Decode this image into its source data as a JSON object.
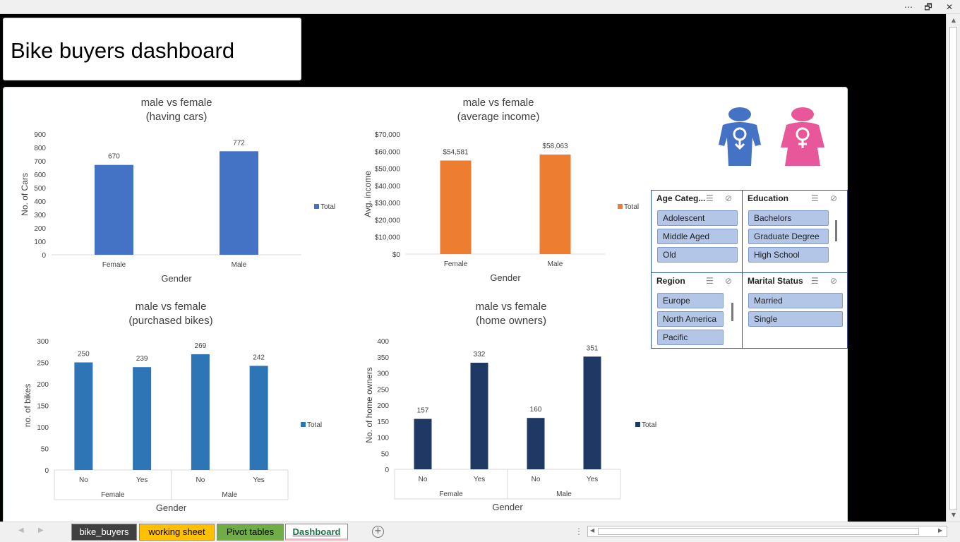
{
  "window": {
    "more_icon": "⋯",
    "restore_icon": "🗗",
    "close_icon": "✕"
  },
  "dashboard": {
    "title": "Bike buyers dashboard"
  },
  "charts": [
    {
      "id": "cars",
      "title_line1": "male vs female",
      "title_line2": "(having cars)",
      "xlabel": "Gender",
      "ylabel": "No. of Cars",
      "legend": "Total",
      "color": "#4472c4"
    },
    {
      "id": "income",
      "title_line1": "male vs female",
      "title_line2": "(average income)",
      "xlabel": "Gender",
      "ylabel": "Avg. income",
      "legend": "Total",
      "color": "#ed7d31"
    },
    {
      "id": "bikes",
      "title_line1": "male vs female",
      "title_line2": "(purchased bikes)",
      "xlabel": "Gender",
      "ylabel": "no. of bikes",
      "legend": "Total",
      "color": "#2e75b6"
    },
    {
      "id": "home",
      "title_line1": "male vs female",
      "title_line2": "(home owners)",
      "xlabel": "Gender",
      "ylabel": "No. of home owners",
      "legend": "Total",
      "color": "#203864"
    }
  ],
  "chart_data": [
    {
      "type": "bar",
      "title": "male vs female (having cars)",
      "xlabel": "Gender",
      "ylabel": "No. of Cars",
      "categories": [
        "Female",
        "Male"
      ],
      "series": [
        {
          "name": "Total",
          "values": [
            670,
            772
          ]
        }
      ],
      "data_labels": [
        "670",
        "772"
      ],
      "yticks": [
        "0",
        "100",
        "200",
        "300",
        "400",
        "500",
        "600",
        "700",
        "800",
        "900"
      ],
      "ylim": [
        0,
        900
      ],
      "legend_position": "right",
      "grid": false
    },
    {
      "type": "bar",
      "title": "male vs female (average income)",
      "xlabel": "Gender",
      "ylabel": "Avg. income",
      "categories": [
        "Female",
        "Male"
      ],
      "series": [
        {
          "name": "Total",
          "values": [
            54581,
            58063
          ]
        }
      ],
      "data_labels": [
        "$54,581",
        "$58,063"
      ],
      "yticks": [
        "$0",
        "$10,000",
        "$20,000",
        "$30,000",
        "$40,000",
        "$50,000",
        "$60,000",
        "$70,000"
      ],
      "ylim": [
        0,
        70000
      ],
      "legend_position": "right",
      "grid": false
    },
    {
      "type": "bar",
      "title": "male vs female (purchased bikes)",
      "xlabel": "Gender",
      "ylabel": "no. of bikes",
      "groups": [
        "Female",
        "Male"
      ],
      "categories": [
        "No",
        "Yes",
        "No",
        "Yes"
      ],
      "series": [
        {
          "name": "Total",
          "values": [
            250,
            239,
            269,
            242
          ]
        }
      ],
      "data_labels": [
        "250",
        "239",
        "269",
        "242"
      ],
      "yticks": [
        "0",
        "50",
        "100",
        "150",
        "200",
        "250",
        "300"
      ],
      "ylim": [
        0,
        300
      ],
      "legend_position": "right",
      "grid": false
    },
    {
      "type": "bar",
      "title": "male vs female (home owners)",
      "xlabel": "Gender",
      "ylabel": "No. of home owners",
      "groups": [
        "Female",
        "Male"
      ],
      "categories": [
        "No",
        "Yes",
        "No",
        "Yes"
      ],
      "series": [
        {
          "name": "Total",
          "values": [
            157,
            332,
            160,
            351
          ]
        }
      ],
      "data_labels": [
        "157",
        "332",
        "160",
        "351"
      ],
      "yticks": [
        "0",
        "50",
        "100",
        "150",
        "200",
        "250",
        "300",
        "350",
        "400"
      ],
      "ylim": [
        0,
        400
      ],
      "legend_position": "right",
      "grid": false
    }
  ],
  "icons": {
    "male_color": "#4472c4",
    "female_color": "#e8579a"
  },
  "slicers": {
    "age": {
      "title": "Age Categ...",
      "items": [
        "Adolescent",
        "Middle Aged",
        "Old"
      ]
    },
    "education": {
      "title": "Education",
      "items": [
        "Bachelors",
        "Graduate Degree",
        "High School"
      ]
    },
    "region": {
      "title": "Region",
      "items": [
        "Europe",
        "North America",
        "Pacific"
      ]
    },
    "marital": {
      "title": "Marital Status",
      "items": [
        "Married",
        "Single"
      ]
    },
    "multiselect_icon": "☰",
    "clear_icon": "⊘"
  },
  "tabs": [
    {
      "label": "bike_buyers",
      "bg": "#404040",
      "fg": "#ffffff",
      "active": false
    },
    {
      "label": "working sheet",
      "bg": "#ffc000",
      "fg": "#000000",
      "active": false
    },
    {
      "label": "Pivot tables",
      "bg": "#70ad47",
      "fg": "#000000",
      "active": false
    },
    {
      "label": "Dashboard",
      "bg": "#ffffff",
      "fg": "#217346",
      "active": true
    }
  ],
  "footer": {
    "add_sheet": "+",
    "nav_prev": "◀",
    "nav_next": "▶",
    "options": "⋮"
  }
}
